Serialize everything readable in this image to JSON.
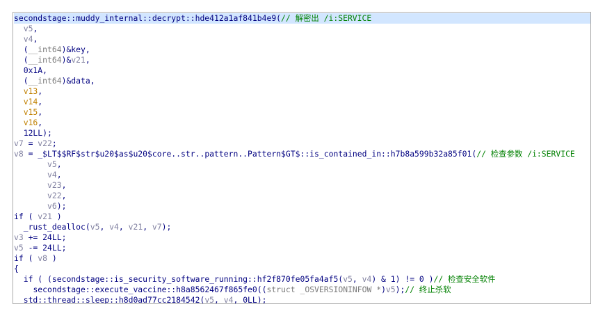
{
  "lines": [
    {
      "indent": "",
      "tokens": [
        {
          "k": "t",
          "s": "secondstage::muddy_internal::decrypt::hde412a1af841b4e9("
        },
        {
          "k": "c",
          "s": "// 解密出 /i:SERVICE"
        }
      ]
    },
    {
      "indent": "  ",
      "tokens": [
        {
          "k": "v",
          "s": "v5"
        },
        {
          "k": "t",
          "s": ","
        }
      ]
    },
    {
      "indent": "  ",
      "tokens": [
        {
          "k": "v",
          "s": "v4"
        },
        {
          "k": "t",
          "s": ","
        }
      ]
    },
    {
      "indent": "  ",
      "tokens": [
        {
          "k": "t",
          "s": "("
        },
        {
          "k": "g",
          "s": "__int64"
        },
        {
          "k": "t",
          "s": ")&key,"
        }
      ]
    },
    {
      "indent": "  ",
      "tokens": [
        {
          "k": "t",
          "s": "("
        },
        {
          "k": "g",
          "s": "__int64"
        },
        {
          "k": "t",
          "s": ")&"
        },
        {
          "k": "v",
          "s": "v21"
        },
        {
          "k": "t",
          "s": ","
        }
      ]
    },
    {
      "indent": "  ",
      "tokens": [
        {
          "k": "t",
          "s": "0x1A,"
        }
      ]
    },
    {
      "indent": "  ",
      "tokens": [
        {
          "k": "t",
          "s": "("
        },
        {
          "k": "g",
          "s": "__int64"
        },
        {
          "k": "t",
          "s": ")&data,"
        }
      ]
    },
    {
      "indent": "  ",
      "tokens": [
        {
          "k": "v2",
          "s": "v13"
        },
        {
          "k": "t",
          "s": ","
        }
      ]
    },
    {
      "indent": "  ",
      "tokens": [
        {
          "k": "v2",
          "s": "v14"
        },
        {
          "k": "t",
          "s": ","
        }
      ]
    },
    {
      "indent": "  ",
      "tokens": [
        {
          "k": "v2",
          "s": "v15"
        },
        {
          "k": "t",
          "s": ","
        }
      ]
    },
    {
      "indent": "  ",
      "tokens": [
        {
          "k": "v2",
          "s": "v16"
        },
        {
          "k": "t",
          "s": ","
        }
      ]
    },
    {
      "indent": "  ",
      "tokens": [
        {
          "k": "t",
          "s": "12LL);"
        }
      ]
    },
    {
      "indent": "",
      "tokens": [
        {
          "k": "v",
          "s": "v7"
        },
        {
          "k": "t",
          "s": " = "
        },
        {
          "k": "v",
          "s": "v22"
        },
        {
          "k": "t",
          "s": ";"
        }
      ]
    },
    {
      "indent": "",
      "tokens": [
        {
          "k": "v",
          "s": "v8"
        },
        {
          "k": "t",
          "s": " = _$LT$$RF$str$u20$as$u20$core..str..pattern..Pattern$GT$::is_contained_in::h7b8a599b32a85f01("
        },
        {
          "k": "c",
          "s": "// 检查参数 /i:SERVICE"
        }
      ]
    },
    {
      "indent": "       ",
      "tokens": [
        {
          "k": "v",
          "s": "v5"
        },
        {
          "k": "t",
          "s": ","
        }
      ]
    },
    {
      "indent": "       ",
      "tokens": [
        {
          "k": "v",
          "s": "v4"
        },
        {
          "k": "t",
          "s": ","
        }
      ]
    },
    {
      "indent": "       ",
      "tokens": [
        {
          "k": "v",
          "s": "v23"
        },
        {
          "k": "t",
          "s": ","
        }
      ]
    },
    {
      "indent": "       ",
      "tokens": [
        {
          "k": "v",
          "s": "v22"
        },
        {
          "k": "t",
          "s": ","
        }
      ]
    },
    {
      "indent": "       ",
      "tokens": [
        {
          "k": "v",
          "s": "v6"
        },
        {
          "k": "t",
          "s": ");"
        }
      ]
    },
    {
      "indent": "",
      "tokens": [
        {
          "k": "t",
          "s": "if ( "
        },
        {
          "k": "v",
          "s": "v21"
        },
        {
          "k": "t",
          "s": " )"
        }
      ]
    },
    {
      "indent": "  ",
      "tokens": [
        {
          "k": "t",
          "s": "_rust_dealloc("
        },
        {
          "k": "v",
          "s": "v5"
        },
        {
          "k": "t",
          "s": ", "
        },
        {
          "k": "v",
          "s": "v4"
        },
        {
          "k": "t",
          "s": ", "
        },
        {
          "k": "v",
          "s": "v21"
        },
        {
          "k": "t",
          "s": ", "
        },
        {
          "k": "v",
          "s": "v7"
        },
        {
          "k": "t",
          "s": ");"
        }
      ]
    },
    {
      "indent": "",
      "tokens": [
        {
          "k": "v",
          "s": "v3"
        },
        {
          "k": "t",
          "s": " += 24LL;"
        }
      ]
    },
    {
      "indent": "",
      "tokens": [
        {
          "k": "v",
          "s": "v5"
        },
        {
          "k": "t",
          "s": " -= 24LL;"
        }
      ]
    },
    {
      "indent": "",
      "tokens": [
        {
          "k": "t",
          "s": "if ( "
        },
        {
          "k": "v",
          "s": "v8"
        },
        {
          "k": "t",
          "s": " )"
        }
      ]
    },
    {
      "indent": "",
      "tokens": [
        {
          "k": "t",
          "s": "{"
        }
      ]
    },
    {
      "indent": "  ",
      "tokens": [
        {
          "k": "t",
          "s": "if ( (secondstage::is_security_software_running::hf2f870fe05fa4af5("
        },
        {
          "k": "v",
          "s": "v5"
        },
        {
          "k": "t",
          "s": ", "
        },
        {
          "k": "v",
          "s": "v4"
        },
        {
          "k": "t",
          "s": ") & 1) != 0 )"
        },
        {
          "k": "c",
          "s": "// 检查安全软件"
        }
      ]
    },
    {
      "indent": "    ",
      "tokens": [
        {
          "k": "t",
          "s": "secondstage::execute_vaccine::h8a8562467f865fe0(("
        },
        {
          "k": "g",
          "s": "struct _OSVERSIONINFOW *"
        },
        {
          "k": "t",
          "s": ")"
        },
        {
          "k": "v",
          "s": "v5"
        },
        {
          "k": "t",
          "s": ");"
        },
        {
          "k": "c",
          "s": "// 终止杀软"
        }
      ]
    },
    {
      "indent": "  ",
      "tokens": [
        {
          "k": "t",
          "s": "std::thread::sleep::h8d0ad77cc2184542("
        },
        {
          "k": "v",
          "s": "v5"
        },
        {
          "k": "t",
          "s": ", "
        },
        {
          "k": "v",
          "s": "v4"
        },
        {
          "k": "t",
          "s": ", 0LL);"
        }
      ]
    }
  ]
}
